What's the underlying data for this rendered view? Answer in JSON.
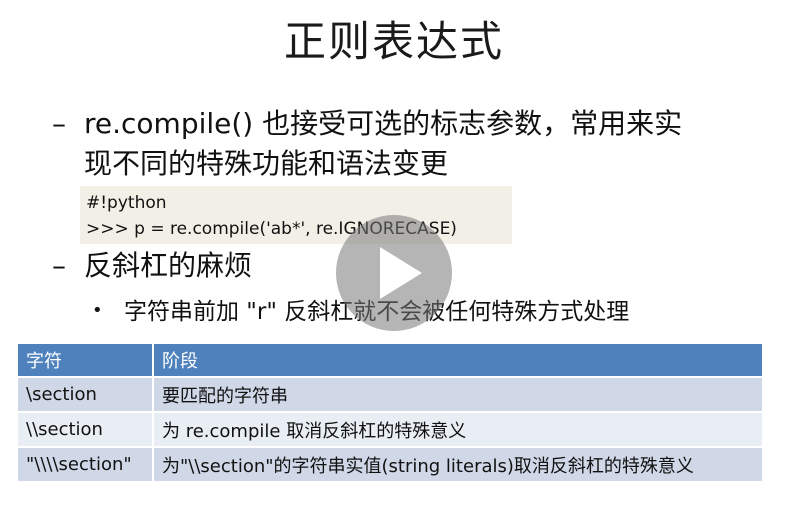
{
  "slide": {
    "title": "正则表达式",
    "item1_dash": "–",
    "item1_code": "re.compile()",
    "item1_text_line1": " 也接受可选的标志参数，常用来实",
    "item1_text_line2": "现不同的特殊功能和语法变更",
    "code_line1": "#!python",
    "code_line2": ">>> p = re.compile('ab*', re.IGNORECASE)",
    "item2_dash": "–",
    "item2_text": "反斜杠的麻烦",
    "bullet_dot": "•",
    "bullet_text": "字符串前加 \"r\" 反斜杠就不会被任何特殊方式处理"
  },
  "table": {
    "headers": [
      "字符",
      "阶段"
    ],
    "rows": [
      [
        "\\section",
        "要匹配的字符串"
      ],
      [
        "\\\\section",
        "为 re.compile 取消反斜杠的特殊意义"
      ],
      [
        "\"\\\\\\\\section\"",
        "为\"\\\\section\"的字符串实值(string literals)取消反斜杠的特殊意义"
      ]
    ]
  },
  "overlay": {
    "icon": "play-icon"
  },
  "colors": {
    "header": "#4f81bd",
    "row_odd": "#d0d8e8",
    "row_even": "#e9edf4",
    "code_bg": "#f2f0e6"
  }
}
